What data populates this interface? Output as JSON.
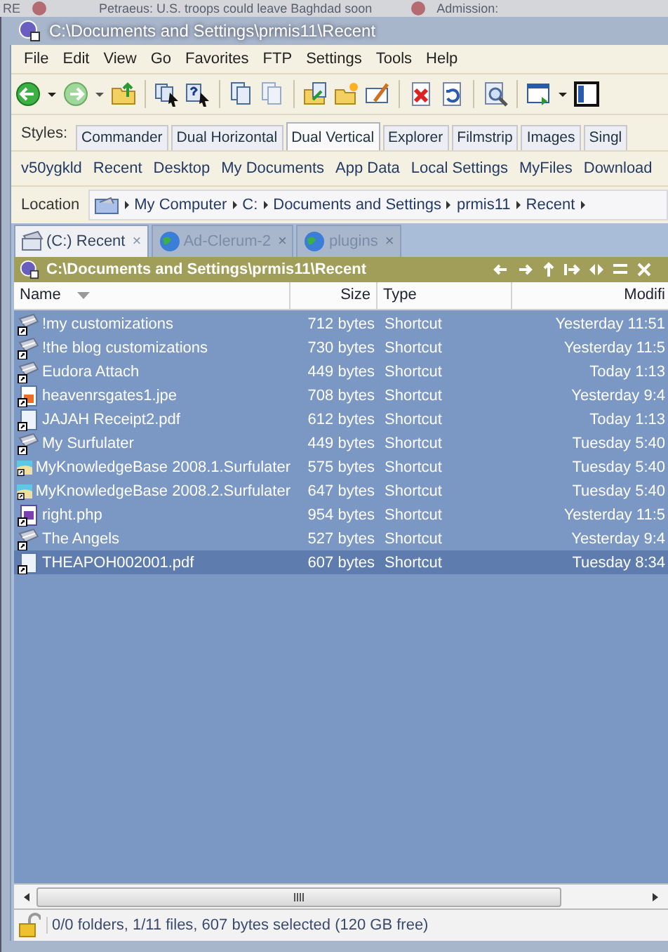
{
  "background": {
    "texts": [
      "RE",
      "Petraeus: U.S. troops could leave Baghdad soon",
      "Admission:"
    ]
  },
  "window": {
    "title": "C:\\Documents and Settings\\prmis11\\Recent"
  },
  "menu": [
    "File",
    "Edit",
    "View",
    "Go",
    "Favorites",
    "FTP",
    "Settings",
    "Tools",
    "Help"
  ],
  "styles": {
    "label": "Styles:",
    "tabs": [
      {
        "label": "Commander",
        "selected": false
      },
      {
        "label": "Dual Horizontal",
        "selected": false
      },
      {
        "label": "Dual Vertical",
        "selected": true
      },
      {
        "label": "Explorer",
        "selected": false
      },
      {
        "label": "Filmstrip",
        "selected": false
      },
      {
        "label": "Images",
        "selected": false
      },
      {
        "label": "Singl",
        "selected": false
      }
    ]
  },
  "favorites": [
    "v50ygkld",
    "Recent",
    "Desktop",
    "My Documents",
    "App Data",
    "Local Settings",
    "MyFiles",
    "Download"
  ],
  "location": {
    "label": "Location",
    "crumbs": [
      "My Computer",
      "C:",
      "Documents and Settings",
      "prmis11",
      "Recent"
    ]
  },
  "tabs": [
    {
      "label": "(C:) Recent",
      "close": "×",
      "selected": true,
      "kind": "folder"
    },
    {
      "label": "Ad-Clerum-2",
      "close": "×",
      "selected": false,
      "kind": "web"
    },
    {
      "label": "plugins",
      "close": "×",
      "selected": false,
      "kind": "web"
    }
  ],
  "panel": {
    "title": "C:\\Documents and Settings\\prmis11\\Recent",
    "columns": [
      "Name",
      "Size",
      "Type",
      "Modifi"
    ],
    "rows": [
      {
        "name": "!my customizations",
        "size": "712 bytes",
        "type": "Shortcut",
        "modified": "Yesterday 11:51",
        "kind": "folder",
        "selected": false
      },
      {
        "name": "!the blog customizations",
        "size": "730 bytes",
        "type": "Shortcut",
        "modified": "Yesterday 11:5",
        "kind": "folder",
        "selected": false
      },
      {
        "name": "Eudora Attach",
        "size": "449 bytes",
        "type": "Shortcut",
        "modified": "Today 1:13",
        "kind": "folder",
        "selected": false
      },
      {
        "name": "heavenrsgates1.jpe",
        "size": "708 bytes",
        "type": "Shortcut",
        "modified": "Yesterday 9:4",
        "kind": "image",
        "selected": false
      },
      {
        "name": "JAJAH Receipt2.pdf",
        "size": "612 bytes",
        "type": "Shortcut",
        "modified": "Today 1:13",
        "kind": "document",
        "selected": false
      },
      {
        "name": "My Surfulater",
        "size": "449 bytes",
        "type": "Shortcut",
        "modified": "Tuesday 5:40",
        "kind": "folder",
        "selected": false
      },
      {
        "name": "MyKnowledgeBase 2008.1.Surfulater",
        "size": "575 bytes",
        "type": "Shortcut",
        "modified": "Tuesday 5:40",
        "kind": "surfulater",
        "selected": false
      },
      {
        "name": "MyKnowledgeBase 2008.2.Surfulater",
        "size": "647 bytes",
        "type": "Shortcut",
        "modified": "Tuesday 5:40",
        "kind": "surfulater",
        "selected": false
      },
      {
        "name": "right.php",
        "size": "954 bytes",
        "type": "Shortcut",
        "modified": "Yesterday 11:5",
        "kind": "php",
        "selected": false
      },
      {
        "name": "The Angels",
        "size": "527 bytes",
        "type": "Shortcut",
        "modified": "Yesterday 9:4",
        "kind": "folder",
        "selected": false
      },
      {
        "name": "THEAPOH002001.pdf",
        "size": "607 bytes",
        "type": "Shortcut",
        "modified": "Tuesday 8:34",
        "kind": "document",
        "selected": true
      }
    ]
  },
  "status_bar": "0/0 folders, 1/11 files, 607 bytes selected (120 GB free)"
}
